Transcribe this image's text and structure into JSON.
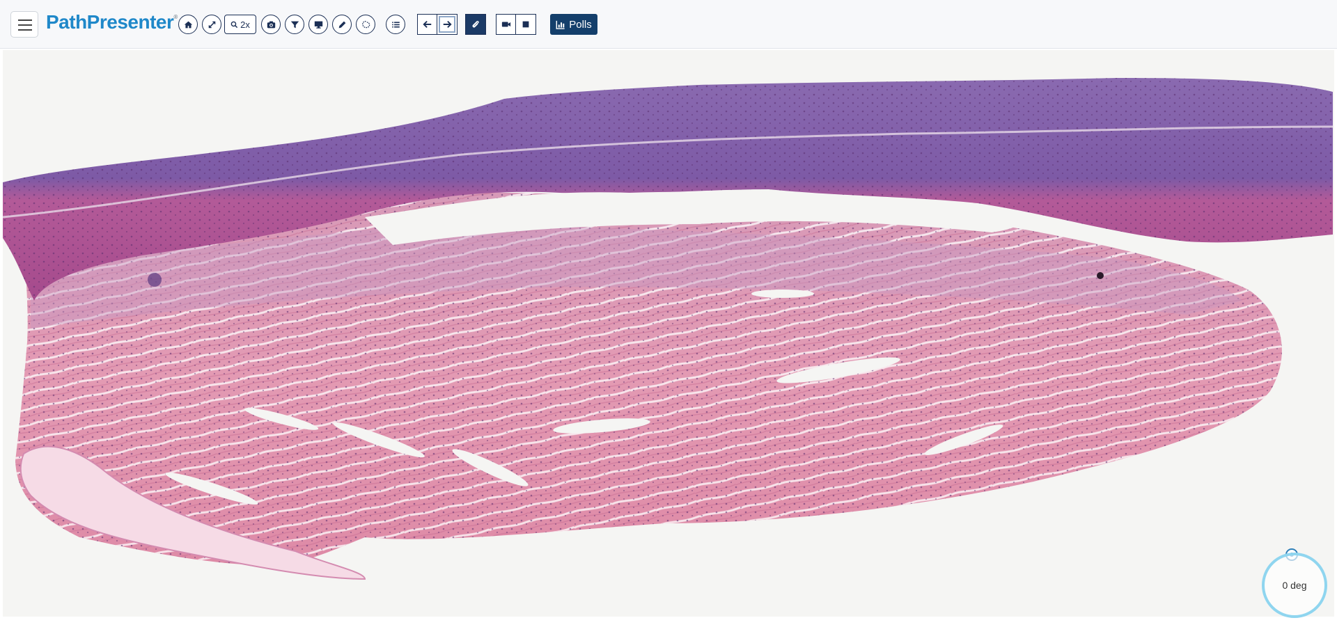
{
  "app": {
    "logo": "PathPresenter",
    "logo_mark": "®"
  },
  "toolbar": {
    "zoom_label": "2x",
    "polls_label": "Polls",
    "buttons": [
      "home-icon",
      "expand-icon",
      "zoom-icon",
      "camera-icon",
      "filter-icon",
      "monitor-icon",
      "pencil-icon",
      "lasso-icon",
      "list-icon",
      "arrow-left-icon",
      "arrow-right-icon",
      "paperclip-icon",
      "video-icon",
      "stop-icon",
      "bar-chart-icon"
    ]
  },
  "viewer": {
    "rotation_label": "0 deg"
  },
  "colors": {
    "primary": "#1b2f55",
    "brand": "#1f88c9",
    "polls_bg": "#143f6b",
    "rotate_ring": "#8fd5ef"
  }
}
